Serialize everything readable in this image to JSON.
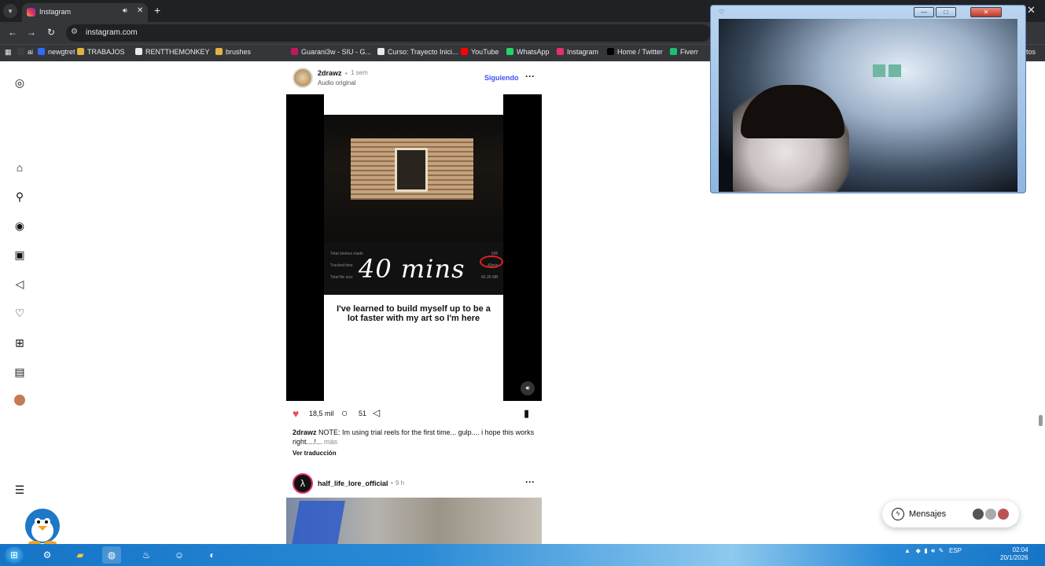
{
  "browser": {
    "tab_title": "Instagram",
    "url": "instagram.com",
    "bookmarks": [
      {
        "label": "ai",
        "color": "#3c4043"
      },
      {
        "label": "newgtret",
        "color": "#2f6df6"
      },
      {
        "label": "TRABAJOS",
        "color": "#e3b341"
      },
      {
        "label": "RENTTHEMONKEY",
        "color": "#e8eaed"
      },
      {
        "label": "brushes",
        "color": "#e3b341"
      },
      {
        "label": "Guarani3w - SIU - G...",
        "color": "#c2185b"
      },
      {
        "label": "Curso: Trayecto Inici...",
        "color": "#e8eaed"
      },
      {
        "label": "YouTube",
        "color": "#ff0000"
      },
      {
        "label": "WhatsApp",
        "color": "#25d366"
      },
      {
        "label": "Instagram",
        "color": "#e1306c"
      },
      {
        "label": "Home / Twitter",
        "color": "#000000"
      },
      {
        "label": "Fiverr",
        "color": "#1dbf73"
      }
    ],
    "bookmarks_overflow": "ritos"
  },
  "sidebar": {
    "icons": [
      "instagram-logo-icon",
      "home-icon",
      "search-icon",
      "explore-icon",
      "reels-icon",
      "direct-icon",
      "notifications-icon",
      "create-icon",
      "dashboard-icon",
      "profile-avatar",
      "menu-icon"
    ]
  },
  "post1": {
    "username": "2drawz",
    "time": "1 sem",
    "audio": "Audio original",
    "following": "Siguiendo",
    "video_text": {
      "big": "40 mins",
      "caption": "I've learned to build myself up to be a lot faster with my art so I'm here"
    },
    "likes": "18,5 mil",
    "comments": "51",
    "caption_user": "2drawz",
    "caption_text": "NOTE: Im using trial reels for the first time... gulp.... i hope this works right....!...",
    "more": "más",
    "translate": "Ver traducción"
  },
  "post2": {
    "username": "half_life_lore_official",
    "time": "9 h"
  },
  "messages": {
    "label": "Mensajes"
  },
  "taskbar": {
    "lang": "ESP",
    "time": "02:04",
    "date": "20/1/2026"
  },
  "colors": {
    "like": "#ed4956",
    "link": "#4150f7",
    "chrome_dark": "#202124"
  }
}
